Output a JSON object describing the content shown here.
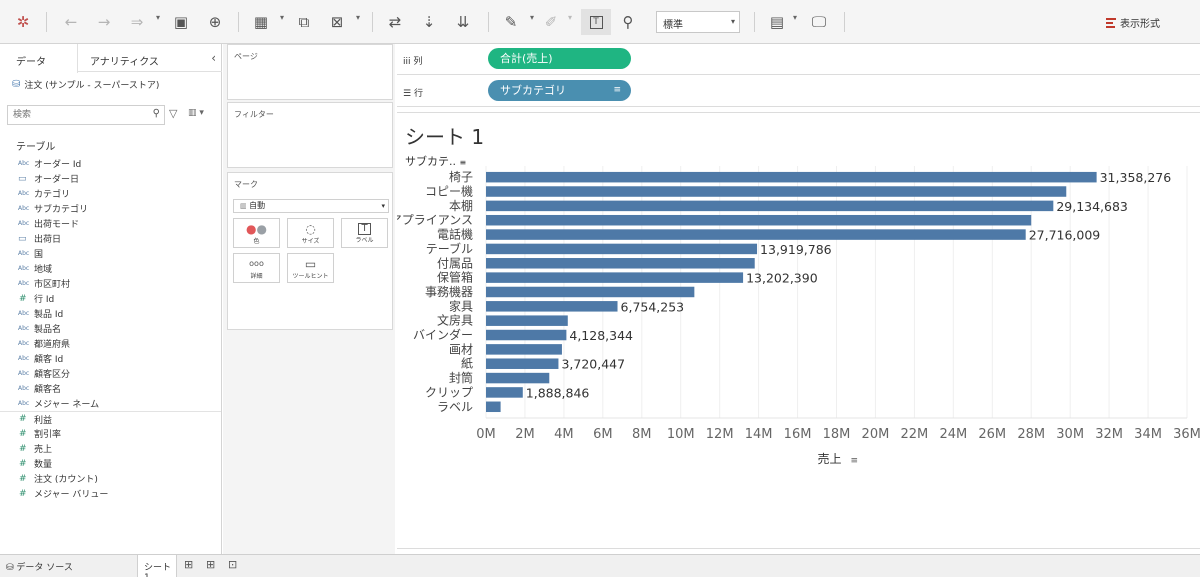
{
  "toolbar": {
    "fit_value": "標準",
    "showme_label": "表示形式"
  },
  "datapane": {
    "tab_data": "データ",
    "tab_analytics": "アナリティクス",
    "datasource": "注文 (サンプル - スーパーストア)",
    "search_placeholder": "検索",
    "tables_heading": "テーブル",
    "fields": [
      {
        "type": "Abc",
        "name": "オーダー Id"
      },
      {
        "type": "date",
        "name": "オーダー日"
      },
      {
        "type": "Abc",
        "name": "カテゴリ"
      },
      {
        "type": "Abc",
        "name": "サブカテゴリ"
      },
      {
        "type": "Abc",
        "name": "出荷モード"
      },
      {
        "type": "date",
        "name": "出荷日"
      },
      {
        "type": "Abc",
        "name": "国"
      },
      {
        "type": "Abc",
        "name": "地域"
      },
      {
        "type": "Abc",
        "name": "市区町村"
      },
      {
        "type": "#",
        "name": "行 Id"
      },
      {
        "type": "Abc",
        "name": "製品 Id"
      },
      {
        "type": "Abc",
        "name": "製品名"
      },
      {
        "type": "Abc",
        "name": "都道府県"
      },
      {
        "type": "Abc",
        "name": "顧客 Id"
      },
      {
        "type": "Abc",
        "name": "顧客区分"
      },
      {
        "type": "Abc",
        "name": "顧客名"
      },
      {
        "type": "Abc",
        "name": "メジャー ネーム"
      },
      {
        "type": "#",
        "name": "利益"
      },
      {
        "type": "#",
        "name": "割引率"
      },
      {
        "type": "#",
        "name": "売上"
      },
      {
        "type": "#",
        "name": "数量"
      },
      {
        "type": "#",
        "name": "注文 (カウント)"
      },
      {
        "type": "#",
        "name": "メジャー バリュー"
      }
    ]
  },
  "cards": {
    "pages": "ページ",
    "filters": "フィルター",
    "marks": "マーク",
    "mark_type": "自動",
    "color": "色",
    "size": "サイズ",
    "label": "ラベル",
    "detail": "詳細",
    "tooltip": "ツールヒント"
  },
  "shelves": {
    "columns_label": "列",
    "rows_label": "行",
    "columns_pill": "合計(売上)",
    "rows_pill": "サブカテゴリ"
  },
  "view": {
    "sheet_title": "シート 1",
    "row_header": "サブカテ.."
  },
  "bottom": {
    "datasource_tab": "データ ソース",
    "sheet_tab": "シート 1"
  },
  "colors": {
    "bar": "#4e79a7",
    "columns_pill": "#1fb582",
    "rows_pill": "#4a8fb0"
  },
  "chart_data": {
    "type": "bar",
    "orientation": "horizontal",
    "categories": [
      "椅子",
      "コピー機",
      "本棚",
      "アプライアンス",
      "電話機",
      "テーブル",
      "付属品",
      "保管箱",
      "事務機器",
      "家具",
      "文房具",
      "バインダー",
      "画材",
      "紙",
      "封筒",
      "クリップ",
      "ラベル"
    ],
    "values": [
      31358276,
      29800000,
      29134683,
      28000000,
      27716009,
      13919786,
      13800000,
      13202390,
      10700000,
      6754253,
      4200000,
      4128344,
      3900000,
      3720447,
      3250000,
      1888846,
      750000
    ],
    "labels": [
      "31,358,276",
      "",
      "29,134,683",
      "",
      "27,716,009",
      "13,919,786",
      "",
      "13,202,390",
      "",
      "6,754,253",
      "",
      "4,128,344",
      "",
      "3,720,447",
      "",
      "1,888,846",
      ""
    ],
    "xlabel": "売上",
    "xlim": [
      0,
      36000000
    ],
    "ticks": [
      0,
      2000000,
      4000000,
      6000000,
      8000000,
      10000000,
      12000000,
      14000000,
      16000000,
      18000000,
      20000000,
      22000000,
      24000000,
      26000000,
      28000000,
      30000000,
      32000000,
      34000000,
      36000000
    ],
    "tick_labels": [
      "0M",
      "2M",
      "4M",
      "6M",
      "8M",
      "10M",
      "12M",
      "14M",
      "16M",
      "18M",
      "20M",
      "22M",
      "24M",
      "26M",
      "28M",
      "30M",
      "32M",
      "34M",
      "36M"
    ],
    "grid": true
  }
}
